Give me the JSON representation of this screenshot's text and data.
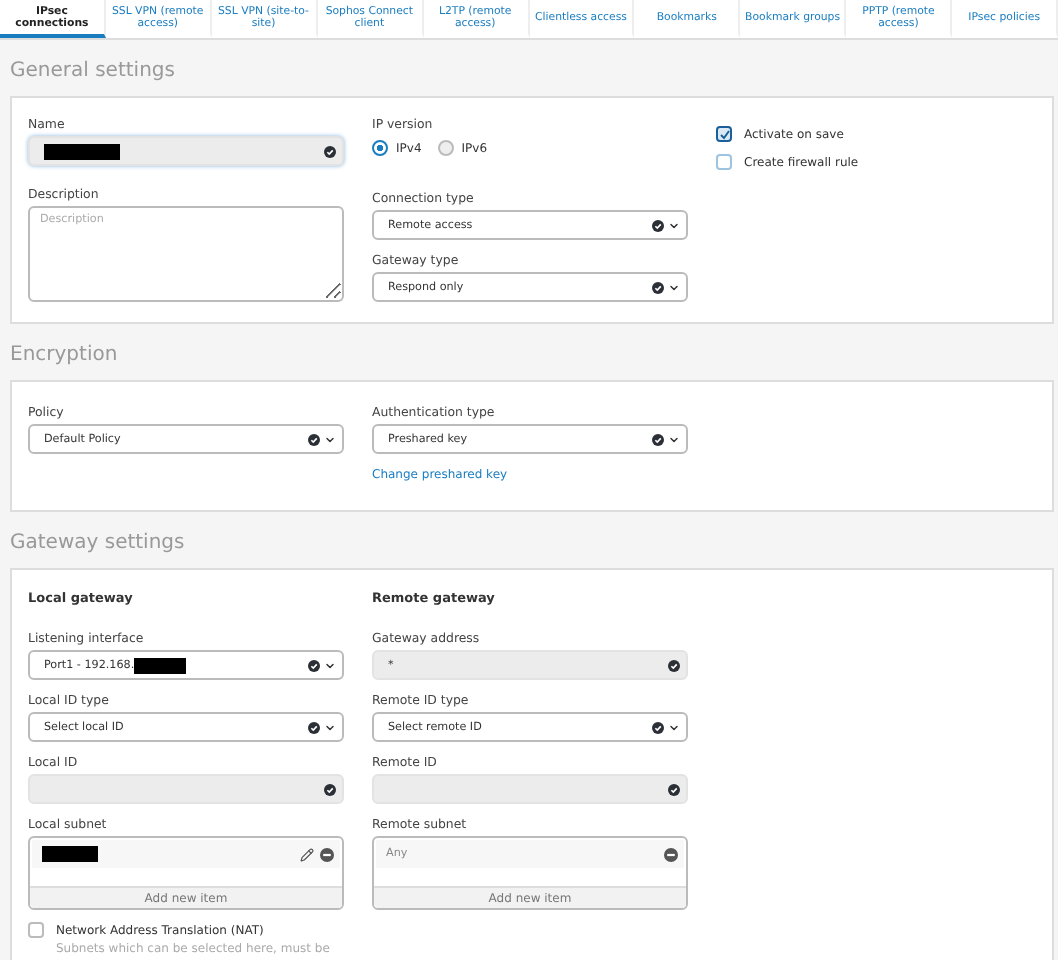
{
  "tabs": [
    {
      "label": "IPsec connections",
      "selected": true
    },
    {
      "label": "SSL VPN (remote access)",
      "selected": false
    },
    {
      "label": "SSL VPN (site-to-site)",
      "selected": false
    },
    {
      "label": "Sophos Connect client",
      "selected": false
    },
    {
      "label": "L2TP (remote access)",
      "selected": false
    },
    {
      "label": "Clientless access",
      "selected": false
    },
    {
      "label": "Bookmarks",
      "selected": false
    },
    {
      "label": "Bookmark groups",
      "selected": false
    },
    {
      "label": "PPTP (remote access)",
      "selected": false
    },
    {
      "label": "IPsec policies",
      "selected": false
    }
  ],
  "general": {
    "title": "General settings",
    "name": {
      "label": "Name",
      "redacted": true
    },
    "description": {
      "label": "Description",
      "placeholder": "Description"
    },
    "ip_version": {
      "label": "IP version",
      "options": [
        {
          "label": "IPv4",
          "selected": true
        },
        {
          "label": "IPv6",
          "selected": false
        }
      ]
    },
    "connection_type": {
      "label": "Connection type",
      "value": "Remote access"
    },
    "gateway_type": {
      "label": "Gateway type",
      "value": "Respond only"
    },
    "options": [
      {
        "label": "Activate on save",
        "checked": true
      },
      {
        "label": "Create firewall rule",
        "checked": false
      }
    ]
  },
  "encryption": {
    "title": "Encryption",
    "policy": {
      "label": "Policy",
      "value": "Default Policy"
    },
    "authentication_type": {
      "label": "Authentication type",
      "value": "Preshared key"
    },
    "link": "Change preshared key"
  },
  "gateway": {
    "title": "Gateway settings",
    "columns": [
      {
        "heading": "Local gateway",
        "fields": [
          {
            "kind": "select",
            "label": "Listening interface",
            "value": "Port1 - 192.168.",
            "redacted": true
          },
          {
            "kind": "select",
            "label": "Local ID type",
            "value": "Select local ID"
          },
          {
            "kind": "text",
            "label": "Local ID"
          }
        ],
        "subnet": {
          "label": "Local subnet",
          "items": [
            {
              "redacted": true,
              "editable": true
            }
          ],
          "add_label": "Add new item"
        }
      },
      {
        "heading": "Remote gateway",
        "fields": [
          {
            "kind": "text",
            "label": "Gateway address",
            "value": "*"
          },
          {
            "kind": "select",
            "label": "Remote ID type",
            "value": "Select remote ID"
          },
          {
            "kind": "text",
            "label": "Remote ID"
          }
        ],
        "subnet": {
          "label": "Remote subnet",
          "items": [
            {
              "text": "Any",
              "editable": false
            }
          ],
          "add_label": "Add new item"
        }
      }
    ],
    "nat": {
      "label": "Network Address Translation (NAT)",
      "checked": false,
      "hint": "Subnets which can be selected here, must be"
    }
  }
}
